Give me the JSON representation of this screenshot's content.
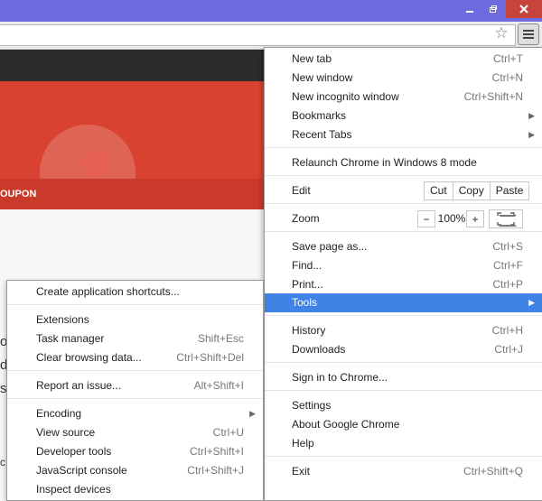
{
  "page": {
    "coupon_text": "OUPON",
    "side_chars": [
      "ol",
      "d",
      "s",
      "c"
    ]
  },
  "menu": {
    "items": {
      "new_tab": {
        "label": "New tab",
        "shortcut": "Ctrl+T"
      },
      "new_window": {
        "label": "New window",
        "shortcut": "Ctrl+N"
      },
      "new_incognito": {
        "label": "New incognito window",
        "shortcut": "Ctrl+Shift+N"
      },
      "bookmarks": {
        "label": "Bookmarks"
      },
      "recent_tabs": {
        "label": "Recent Tabs"
      },
      "relaunch": {
        "label": "Relaunch Chrome in Windows 8 mode"
      },
      "edit": {
        "label": "Edit",
        "cut": "Cut",
        "copy": "Copy",
        "paste": "Paste"
      },
      "zoom": {
        "label": "Zoom",
        "minus": "−",
        "value": "100%",
        "plus": "+"
      },
      "save_page": {
        "label": "Save page as...",
        "shortcut": "Ctrl+S"
      },
      "find": {
        "label": "Find...",
        "shortcut": "Ctrl+F"
      },
      "print": {
        "label": "Print...",
        "shortcut": "Ctrl+P"
      },
      "tools": {
        "label": "Tools"
      },
      "history": {
        "label": "History",
        "shortcut": "Ctrl+H"
      },
      "downloads": {
        "label": "Downloads",
        "shortcut": "Ctrl+J"
      },
      "sign_in": {
        "label": "Sign in to Chrome..."
      },
      "settings": {
        "label": "Settings"
      },
      "about": {
        "label": "About Google Chrome"
      },
      "help": {
        "label": "Help"
      },
      "exit": {
        "label": "Exit",
        "shortcut": "Ctrl+Shift+Q"
      }
    }
  },
  "tools_menu": {
    "items": {
      "create_shortcuts": {
        "label": "Create application shortcuts..."
      },
      "extensions": {
        "label": "Extensions"
      },
      "task_manager": {
        "label": "Task manager",
        "shortcut": "Shift+Esc"
      },
      "clear_browsing": {
        "label": "Clear browsing data...",
        "shortcut": "Ctrl+Shift+Del"
      },
      "report_issue": {
        "label": "Report an issue...",
        "shortcut": "Alt+Shift+I"
      },
      "encoding": {
        "label": "Encoding"
      },
      "view_source": {
        "label": "View source",
        "shortcut": "Ctrl+U"
      },
      "developer_tools": {
        "label": "Developer tools",
        "shortcut": "Ctrl+Shift+I"
      },
      "js_console": {
        "label": "JavaScript console",
        "shortcut": "Ctrl+Shift+J"
      },
      "inspect_devices": {
        "label": "Inspect devices"
      }
    }
  },
  "colors": {
    "highlight": "#3f83e6",
    "titlebar": "#6f6ce0",
    "brand_red": "#d94231"
  },
  "icons": {
    "bookmark": "star-icon",
    "menu": "hamburger-menu-icon",
    "submenu": "chevron-right-icon",
    "fullscreen": "fullscreen-icon"
  }
}
